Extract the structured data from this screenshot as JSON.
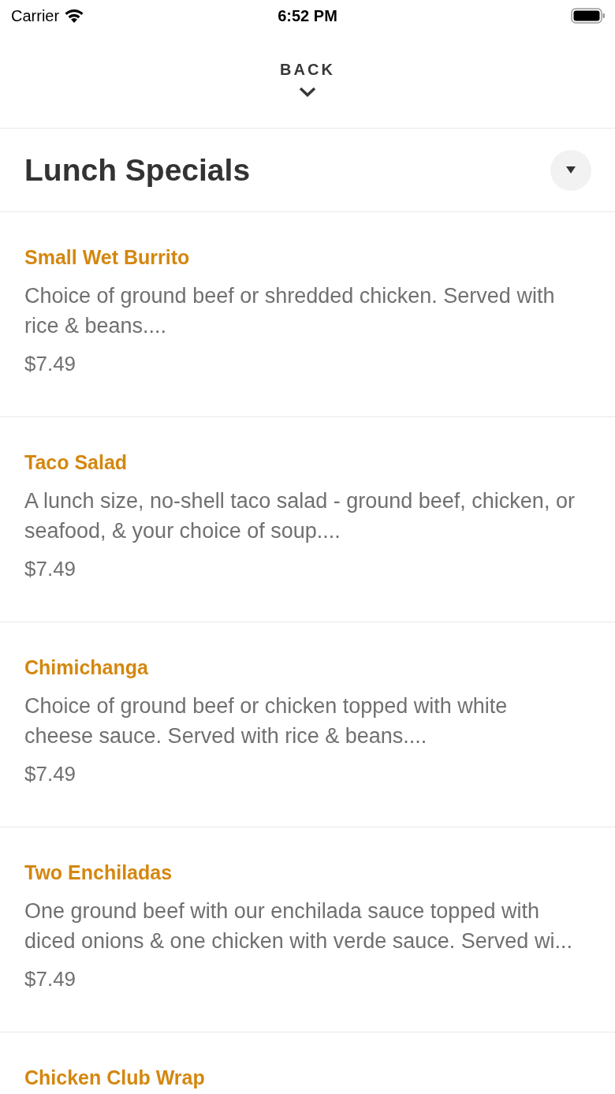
{
  "status_bar": {
    "carrier": "Carrier",
    "time": "6:52 PM"
  },
  "nav": {
    "back_label": "BACK"
  },
  "section": {
    "title": "Lunch Specials"
  },
  "items": [
    {
      "name": "Small Wet Burrito",
      "description": "Choice of ground beef or shredded chicken. Served with rice & beans....",
      "price": "$7.49"
    },
    {
      "name": "Taco Salad",
      "description": "A lunch size, no-shell taco salad - ground beef, chicken, or seafood, & your choice of soup....",
      "price": "$7.49"
    },
    {
      "name": "Chimichanga",
      "description": "Choice of ground beef or chicken topped with white cheese sauce. Served with rice & beans....",
      "price": "$7.49"
    },
    {
      "name": "Two Enchiladas",
      "description": "One ground beef with our enchilada sauce topped with diced onions & one chicken with verde sauce. Served wi...",
      "price": "$7.49"
    },
    {
      "name": "Chicken Club Wrap"
    }
  ]
}
